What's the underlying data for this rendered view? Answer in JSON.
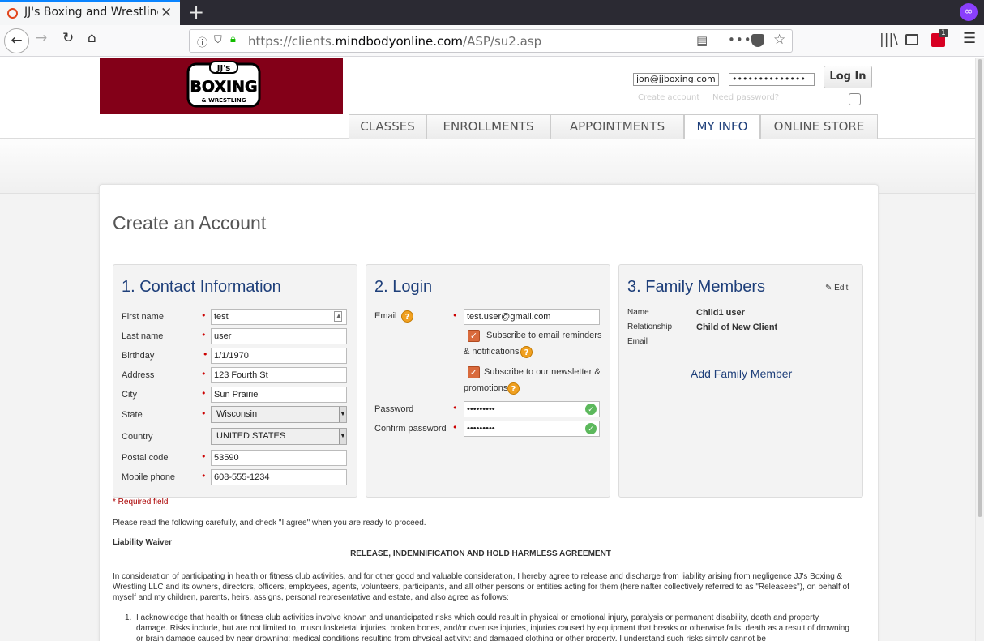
{
  "browser": {
    "tab_title": "JJ's Boxing and Wrestling",
    "new_tab_symbol": "+",
    "close_symbol": "✕",
    "url_prefix": "https://clients.",
    "url_domain": "mindbodyonline.com",
    "url_path": "/ASP/su2.asp",
    "ext_badge": "1"
  },
  "header": {
    "logo_top": "JJ's",
    "logo_main": "BOXING",
    "logo_sub": "& WRESTLING",
    "login_email_value": "jon@jjboxing.com",
    "login_password_value": "••••••••••••••",
    "login_button": "Log In",
    "create_account_link": "Create account",
    "forgot_password_link": "Need password?"
  },
  "nav": {
    "tabs": [
      {
        "label": "CLASSES",
        "active": false
      },
      {
        "label": "ENROLLMENTS",
        "active": false
      },
      {
        "label": "APPOINTMENTS",
        "active": false
      },
      {
        "label": "MY INFO",
        "active": true
      },
      {
        "label": "ONLINE STORE",
        "active": false
      }
    ]
  },
  "form": {
    "page_title": "Create an Account",
    "contact": {
      "title": "1. Contact Information",
      "fields": {
        "first_name": {
          "label": "First name",
          "value": "test"
        },
        "last_name": {
          "label": "Last name",
          "value": "user"
        },
        "birthday": {
          "label": "Birthday",
          "value": "1/1/1970"
        },
        "address": {
          "label": "Address",
          "value": "123 Fourth St"
        },
        "city": {
          "label": "City",
          "value": "Sun Prairie"
        },
        "state": {
          "label": "State",
          "value": "Wisconsin"
        },
        "country": {
          "label": "Country",
          "value": "UNITED STATES"
        },
        "postal_code": {
          "label": "Postal code",
          "value": "53590"
        },
        "mobile_phone": {
          "label": "Mobile phone",
          "value": "608-555-1234"
        }
      }
    },
    "login": {
      "title": "2. Login",
      "email_label": "Email",
      "email_value": "test.user@gmail.com",
      "subscribe_reminders": "Subscribe to email reminders & notifications",
      "subscribe_newsletter": "Subscribe to our newsletter & promotions",
      "password_label": "Password",
      "password_value": "•••••••••",
      "confirm_label": "Confirm password",
      "confirm_value": "•••••••••"
    },
    "family": {
      "title": "3. Family Members",
      "edit_label": "Edit",
      "name_label": "Name",
      "name_value": "Child1 user",
      "relationship_label": "Relationship",
      "relationship_value": "Child of New Client",
      "email_label": "Email",
      "add_link": "Add Family Member"
    },
    "required_note": "* Required field",
    "instructions": "Please read the following carefully, and check \"I agree\" when you are ready to proceed.",
    "waiver_heading": "Liability Waiver",
    "waiver_title": "RELEASE, INDEMNIFICATION AND HOLD HARMLESS AGREEMENT",
    "waiver_intro": "In consideration of participating in health or fitness club activities, and for other good and valuable consideration, I hereby agree to release and discharge from liability arising from negligence JJ's Boxing & Wrestling LLC and its owners, directors, officers, employees, agents, volunteers, participants, and all other persons or entities acting for them (hereinafter collectively referred to as \"Releasees\"), on behalf of myself and my children, parents, heirs, assigns, personal representative and estate, and also agree as follows:",
    "waiver_item_1_num": "1.",
    "waiver_item_1": "I acknowledge that health or fitness club activities involve known and unanticipated risks which could result in physical or emotional injury, paralysis or permanent disability, death and property damage. Risks include, but are not limited to, musculoskeletal injuries, broken bones, and/or overuse injuries, injuries caused by equipment that breaks or otherwise fails; death as a result of drowning or brain damage caused by near drowning; medical conditions resulting from physical activity; and damaged clothing or other property. I understand such risks simply cannot be"
  }
}
